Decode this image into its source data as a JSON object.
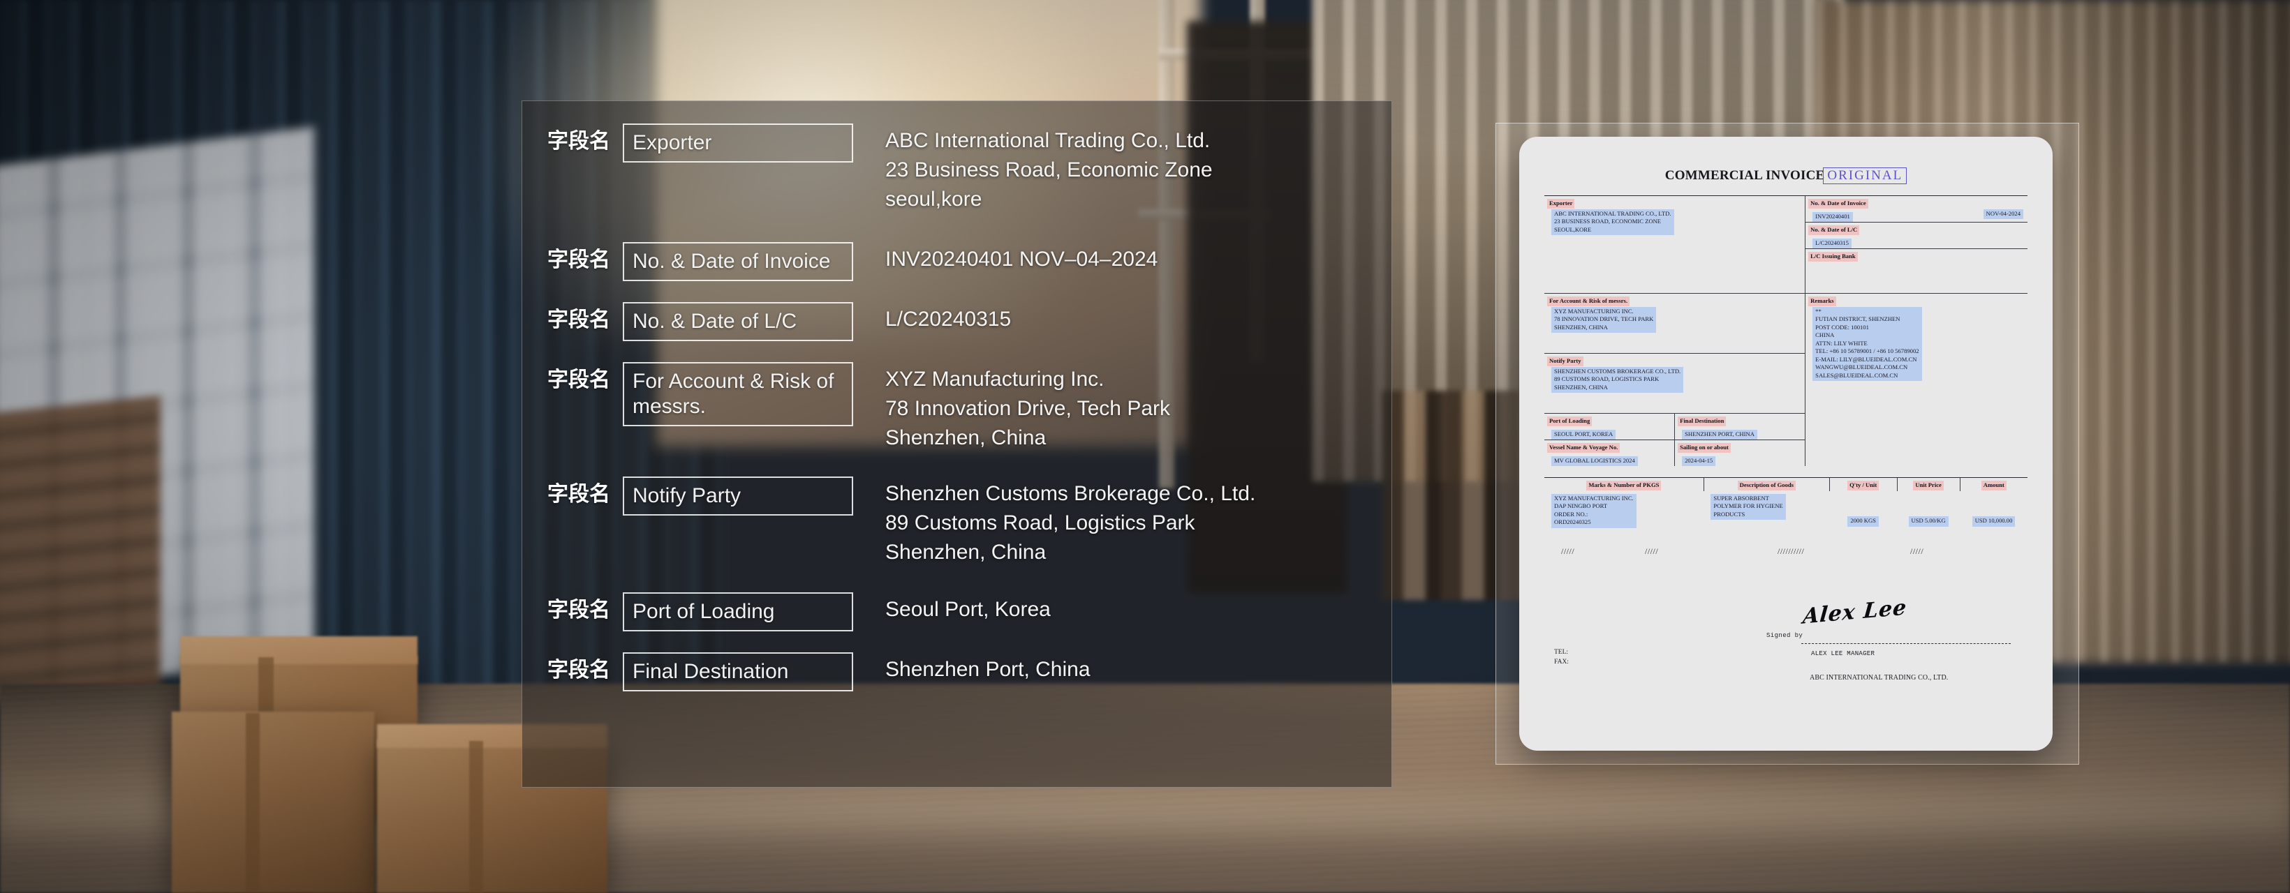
{
  "field_panel": {
    "cjk_label": "字段名",
    "rows": [
      {
        "name": "Exporter",
        "value": "ABC International Trading Co., Ltd.\n23 Business Road, Economic Zone\nseoul,kore"
      },
      {
        "name": "No. & Date of Invoice",
        "value": "INV20240401    NOV–04–2024"
      },
      {
        "name": "No. & Date of L/C",
        "value": "L/C20240315"
      },
      {
        "name": "For Account & Risk of messrs.",
        "value": "XYZ Manufacturing Inc.\n78 Innovation Drive, Tech Park\nShenzhen, China"
      },
      {
        "name": "Notify Party",
        "value": "Shenzhen Customs Brokerage Co., Ltd.\n89 Customs Road, Logistics Park\nShenzhen, China"
      },
      {
        "name": "Port of Loading",
        "value": "Seoul Port, Korea"
      },
      {
        "name": "Final Destination",
        "value": "Shenzhen Port, China"
      }
    ]
  },
  "invoice": {
    "title": "COMMERCIAL INVOICE",
    "stamp": "ORIGINAL",
    "exporter": {
      "label": "Exporter",
      "value": "ABC INTERNATIONAL TRADING CO., LTD.\n23 BUSINESS ROAD, ECONOMIC ZONE\nSEOUL,KORE"
    },
    "invoice_no": {
      "label": "No. & Date of Invoice",
      "number": "INV20240401",
      "date": "NOV-04-2024"
    },
    "lc_no": {
      "label": "No. & Date of L/C",
      "value": "L/C20240315"
    },
    "lc_bank": {
      "label": "L/C Issuing Bank",
      "value": ""
    },
    "account_risk": {
      "label": "For Account & Risk of messrs.",
      "value": "XYZ MANUFACTURING INC.\n78 INNOVATION DRIVE, TECH PARK\nSHENZHEN, CHINA"
    },
    "remarks": {
      "label": "Remarks",
      "value": "**\nFUTIAN DISTRICT, SHENZHEN\nPOST  CODE:  100101\nCHINA\nATTN:  LILY WHITE\nTEL:  +86 10 56789001 / +86 10 56789002\nE-MAIL:  LILY@BLUEIDEAL.COM.CN\nWANGWU@BLUEIDEAL.COM.CN\nSALES@BLUEIDEAL.COM.CN"
    },
    "notify_party": {
      "label": "Notify Party",
      "value": "SHENZHEN CUSTOMS BROKERAGE CO., LTD.\n89 CUSTOMS ROAD, LOGISTICS PARK\nSHENZHEN, CHINA"
    },
    "port_of_loading": {
      "label": "Port of Loading",
      "value": "SEOUL PORT, KOREA"
    },
    "final_destination": {
      "label": "Final Destination",
      "value": "SHENZHEN PORT, CHINA"
    },
    "vessel": {
      "label": "Vessel Name & Voyage No.",
      "value": "MV GLOBAL LOGISTICS 2024"
    },
    "sailing": {
      "label": "Sailing on or about",
      "value": "2024-04-15"
    },
    "goods_table": {
      "headers": {
        "marks": "Marks & Number of PKGS",
        "description": "Description of Goods",
        "qty": "Q'ty / Unit",
        "unit_price": "Unit Price",
        "amount": "Amount"
      },
      "row": {
        "marks": "XYZ MANUFACTURING INC.\nDAP NINGBO PORT\nORDER NO.:\nORD20240325",
        "description": "SUPER ABSORBENT\nPOLYMER FOR HYGIENE\nPRODUCTS",
        "qty": "2000 KGS",
        "unit_price": "USD 5.00/KG",
        "amount": "USD 10,000.00"
      }
    },
    "hatch_marks": {
      "m1": "/////",
      "m2": "/////",
      "m3": "//////////",
      "m4": "/////"
    },
    "signature": {
      "signed_by_label": "Signed by",
      "signature_name": "Alex Lee",
      "signer_role": "ALEX LEE  MANAGER",
      "company": "ABC INTERNATIONAL TRADING CO., LTD."
    },
    "contact": {
      "tel_label": "TEL:",
      "fax_label": "FAX:"
    }
  },
  "colors": {
    "label_highlight": "#f0c3c3",
    "value_highlight": "#b9cdee",
    "stamp": "#5b53c9",
    "paper": "#e8e8e8"
  }
}
